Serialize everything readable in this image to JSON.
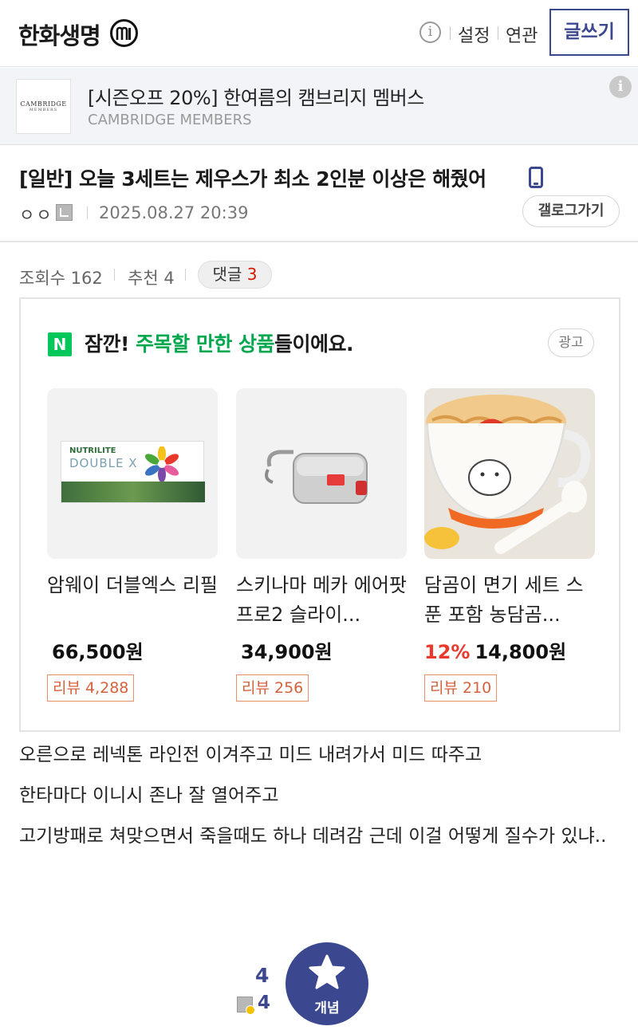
{
  "header": {
    "gallery_title": "한화생명",
    "settings_label": "설정",
    "related_label": "연관",
    "write_label": "글쓰기"
  },
  "ad_banner": {
    "logo_line1": "CAMBRIDGE",
    "logo_line2": "MEMBERS",
    "title": "[시즌오프 20%] 한여름의 캠브리지 멤버스",
    "subtitle": "CAMBRIDGE MEMBERS"
  },
  "post": {
    "title": "[일반] 오늘 3세트는 제우스가 최소 2인분 이상은 해줬어",
    "author": "ㅇㅇ",
    "date": "2025.08.27 20:39",
    "gallog_button": "갤로그가기",
    "views_label": "조회수",
    "views": "162",
    "recommend_label": "추천",
    "recommend": "4",
    "comments_label": "댓글",
    "comments": "3",
    "body": [
      "오른으로 레넥톤 라인전 이겨주고 미드 내려가서 미드 따주고",
      "한타마다 이니시 존나 잘 열어주고",
      "고기방패로 쳐맞으면서 죽을때도 하나 데려감 근데 이걸 어떻게 질수가 있냐.."
    ]
  },
  "product_ad": {
    "logo": "N",
    "headline_prefix": "잠깐! ",
    "headline_highlight": "주목할 만한 상품",
    "headline_suffix": "들이에요.",
    "ad_tag": "광고",
    "products": [
      {
        "name": "암웨이 더블엑스 리필",
        "discount": "",
        "price": "66,500원",
        "review": "리뷰 4,288",
        "thumb_text_1": "NUTRILITE",
        "thumb_text_2": "DOUBLE X"
      },
      {
        "name": "스키나마 메카 에어팟 프로2 슬라이...",
        "discount": "",
        "price": "34,900원",
        "review": "리뷰 256"
      },
      {
        "name": "담곰이 면기 세트 스푼 포함 농담곰...",
        "discount": "12%",
        "price": "14,800원",
        "review": "리뷰 210"
      }
    ]
  },
  "recommend_box": {
    "up_count": "4",
    "fixed_count": "4",
    "button_label": "개념"
  },
  "colors": {
    "brand": "#3b4890",
    "naver_green": "#03c75a",
    "accent_red": "#d31900",
    "review_orange": "#d6623b"
  }
}
